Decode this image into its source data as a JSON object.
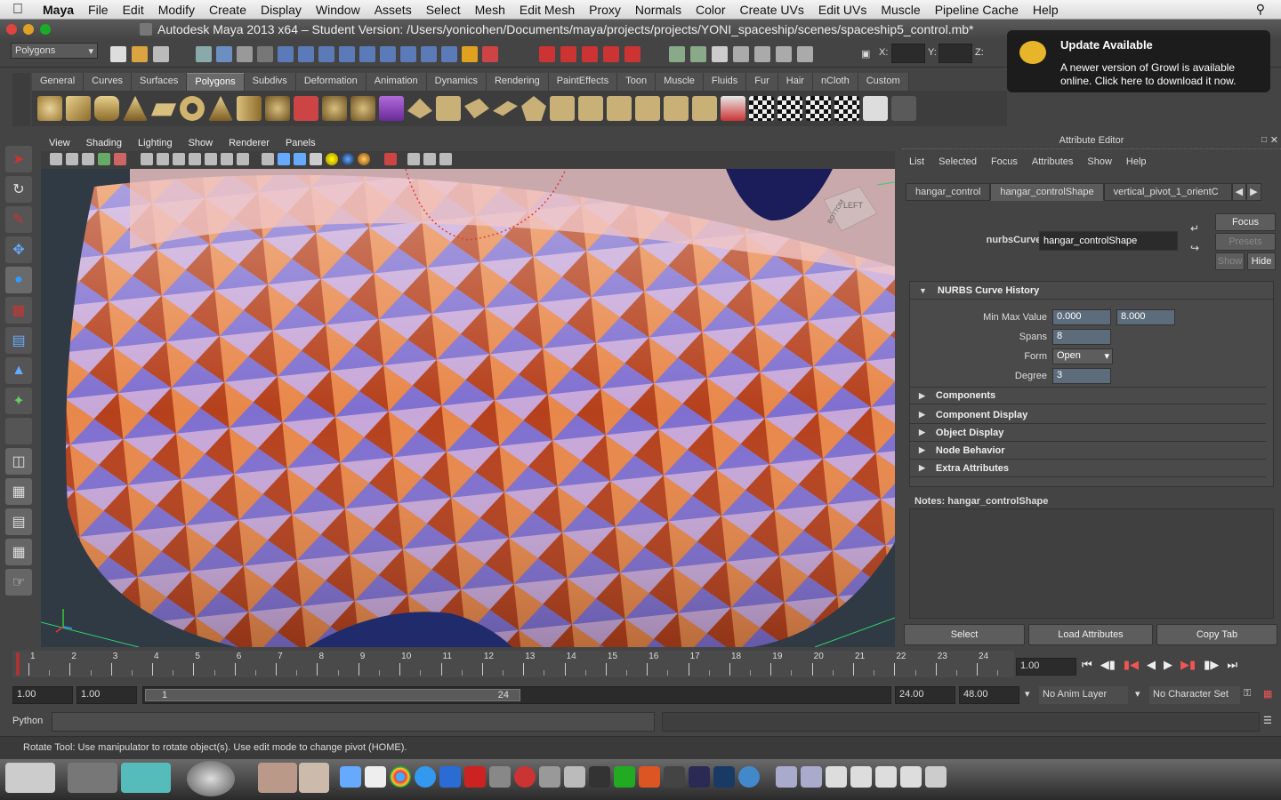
{
  "mac_menu": {
    "apple": "",
    "items": [
      "Maya",
      "File",
      "Edit",
      "Modify",
      "Create",
      "Display",
      "Window",
      "Assets",
      "Select",
      "Mesh",
      "Edit Mesh",
      "Proxy",
      "Normals",
      "Color",
      "Create UVs",
      "Edit UVs",
      "Muscle",
      "Pipeline Cache",
      "Help"
    ]
  },
  "window": {
    "title": "Autodesk Maya 2013 x64 – Student Version: /Users/yonicohen/Documents/maya/projects/projects/YONI_spaceship/scenes/spaceship5_control.mb*",
    "title_suffix": "hangar_control"
  },
  "status_line": {
    "mode": "Polygons",
    "x_label": "X:",
    "y_label": "Y:",
    "z_label": "Z:"
  },
  "growl": {
    "title": "Update Available",
    "message": "A newer version of Growl is available online. Click here to download it now."
  },
  "shelf_tabs": [
    "General",
    "Curves",
    "Surfaces",
    "Polygons",
    "Subdivs",
    "Deformation",
    "Animation",
    "Dynamics",
    "Rendering",
    "PaintEffects",
    "Toon",
    "Muscle",
    "Fluids",
    "Fur",
    "Hair",
    "nCloth",
    "Custom"
  ],
  "active_shelf_tab": "Polygons",
  "viewport": {
    "menus": [
      "View",
      "Shading",
      "Lighting",
      "Show",
      "Renderer",
      "Panels"
    ],
    "viewcube_left": "LEFT",
    "viewcube_bottom": "BOTTOM"
  },
  "attribute_editor": {
    "header": "Attribute Editor",
    "menus": [
      "List",
      "Selected",
      "Focus",
      "Attributes",
      "Show",
      "Help"
    ],
    "tabs": [
      "hangar_control",
      "hangar_controlShape",
      "vertical_pivot_1_orientC"
    ],
    "active_tab": "hangar_controlShape",
    "node_label": "nurbsCurve:",
    "node_value": "hangar_controlShape",
    "buttons": {
      "focus": "Focus",
      "presets": "Presets",
      "show": "Show",
      "hide": "Hide"
    },
    "history_section": "NURBS Curve History",
    "fields": {
      "min_max_label": "Min Max Value",
      "min": "0.000",
      "max": "8.000",
      "spans_label": "Spans",
      "spans": "8",
      "form_label": "Form",
      "form": "Open",
      "degree_label": "Degree",
      "degree": "3"
    },
    "collapsed_sections": [
      "Components",
      "Component Display",
      "Object Display",
      "Node Behavior",
      "Extra Attributes"
    ],
    "notes_label": "Notes:",
    "notes_value": "hangar_controlShape",
    "bottom_buttons": [
      "Select",
      "Load Attributes",
      "Copy Tab"
    ]
  },
  "time_slider": {
    "ticks": [
      "1",
      "2",
      "3",
      "4",
      "5",
      "6",
      "7",
      "8",
      "9",
      "10",
      "11",
      "12",
      "13",
      "14",
      "15",
      "16",
      "17",
      "18",
      "19",
      "20",
      "21",
      "22",
      "23",
      "24"
    ],
    "current_frame": "1.00"
  },
  "range_slider": {
    "start": "1.00",
    "playback_start": "1.00",
    "range_start_label": "1",
    "range_end_label": "24",
    "playback_end": "24.00",
    "end": "48.00",
    "anim_layer": "No Anim Layer",
    "character_set": "No Character Set"
  },
  "command_line": {
    "language": "Python"
  },
  "help_line": {
    "text": "Rotate Tool: Use manipulator to rotate object(s). Use edit mode to change pivot (HOME)."
  },
  "colors": {
    "accent_blue": "#5d6c7b",
    "panel": "#444444",
    "shelf_active": "#6a6a6a"
  }
}
